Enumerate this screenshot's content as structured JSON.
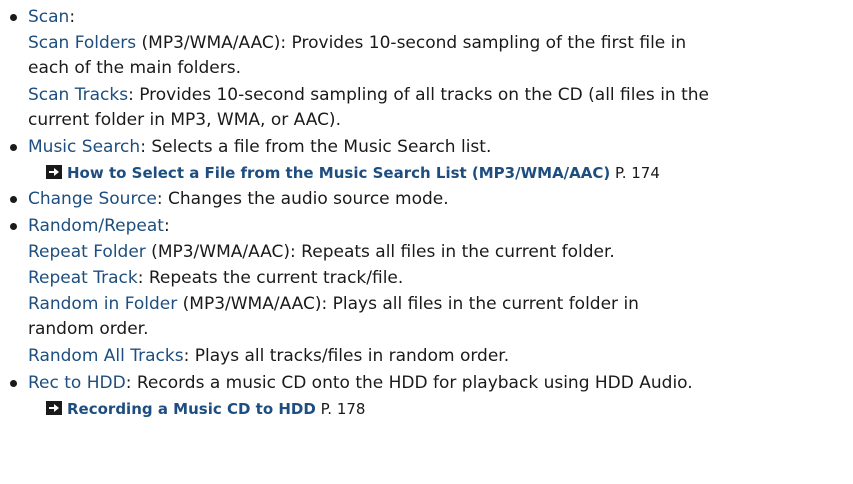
{
  "items": [
    {
      "term": "Scan",
      "term_suffix": ":",
      "subs": [
        {
          "term": "Scan Folders",
          "desc_line1": " (MP3/WMA/AAC): Provides 10-second sampling of the first file in",
          "desc_line2": "each of the main folders."
        },
        {
          "term": "Scan Tracks",
          "desc_line1": ": Provides 10-second sampling of all tracks on the CD (all files in the",
          "desc_line2": "current folder in MP3, WMA, or AAC)."
        }
      ]
    },
    {
      "term": "Music Search",
      "desc": ": Selects a file from the Music Search list.",
      "ref": {
        "text": "How to Select a File from the Music Search List (MP3/WMA/AAC)",
        "page": " P. 174"
      }
    },
    {
      "term": "Change Source",
      "desc": ": Changes the audio source mode."
    },
    {
      "term": "Random/Repeat",
      "term_suffix": ":",
      "subs": [
        {
          "term": "Repeat Folder",
          "desc_line1": " (MP3/WMA/AAC): Repeats all files in the current folder."
        },
        {
          "term": "Repeat Track",
          "desc_line1": ": Repeats the current track/file."
        },
        {
          "term": "Random in Folder",
          "desc_line1": " (MP3/WMA/AAC): Plays all files in the current folder in",
          "desc_line2": "random order."
        },
        {
          "term": "Random All Tracks",
          "desc_line1": ": Plays all tracks/files in random order."
        }
      ]
    },
    {
      "term": "Rec to HDD",
      "desc": ": Records a music CD onto the HDD for playback using HDD Audio.",
      "ref": {
        "text": "Recording a Music CD to HDD",
        "page": " P. 178"
      }
    }
  ],
  "icons": {
    "cross_ref": "arrow-right-box-icon"
  },
  "colors": {
    "keyword": "#1d4e7f",
    "text": "#1a1a1a"
  }
}
